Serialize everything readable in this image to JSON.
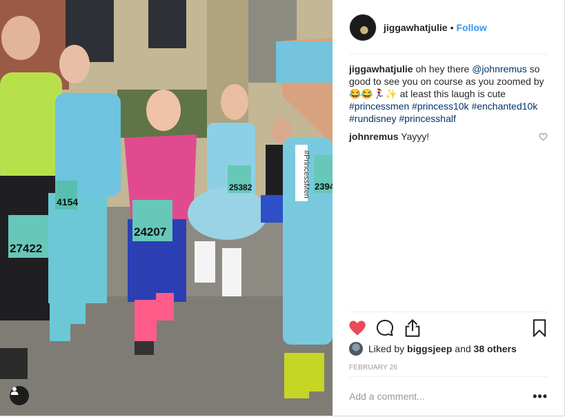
{
  "post": {
    "username": "jiggawhatjulie",
    "follow_label": "Follow",
    "caption": {
      "text_1": "oh hey there",
      "mention": "@johnremus",
      "text_2": "so good to see you on course as you zoomed by 😂😂🏃‍♀️✨ at least this laugh is cute",
      "hashtags": [
        "#princessmen",
        "#princess10k",
        "#enchanted10k",
        "#rundisney",
        "#princesshalf"
      ]
    },
    "comments": [
      {
        "username": "johnremus",
        "text": "Yayyy!"
      }
    ],
    "likes": {
      "prefix": "Liked by",
      "user": "biggsjeep",
      "middle": "and",
      "others": "38 others"
    },
    "date": "FEBRUARY 26",
    "add_comment_placeholder": "Add a comment...",
    "more_label": "•••"
  },
  "photo": {
    "bibs": [
      "27422",
      "4154",
      "24207",
      "25382",
      "2394"
    ],
    "sign_text": "#PrincessMen"
  },
  "colors": {
    "like_red": "#ed4956",
    "follow_blue": "#3897f0",
    "hashtag_blue": "#003569"
  }
}
